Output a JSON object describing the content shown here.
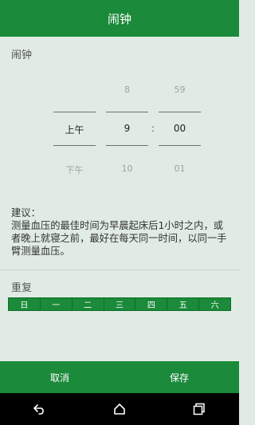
{
  "header": {
    "title": "闹钟"
  },
  "alarm_section": {
    "title": "闹钟"
  },
  "picker": {
    "ampm": {
      "above": "",
      "selected": "上午",
      "below": "下午"
    },
    "hour": {
      "above": "8",
      "selected": "9",
      "below": "10"
    },
    "minute": {
      "above": "59",
      "selected": "00",
      "below": "01"
    },
    "separator": ":"
  },
  "advice": {
    "label": "建议：",
    "text": "测量血压的最佳时间为早晨起床后1小时之内，或者晚上就寝之前，最好在每天同一时间，以同一手臂测量血压。"
  },
  "repeat": {
    "title": "重复",
    "days": [
      "日",
      "一",
      "二",
      "三",
      "四",
      "五",
      "六"
    ]
  },
  "footer": {
    "cancel": "取消",
    "save": "保存"
  },
  "colors": {
    "primary": "#1b8a3a",
    "background": "#e0ece3"
  },
  "navbar": {
    "icons": [
      "back-icon",
      "home-icon",
      "recent-apps-icon"
    ]
  }
}
